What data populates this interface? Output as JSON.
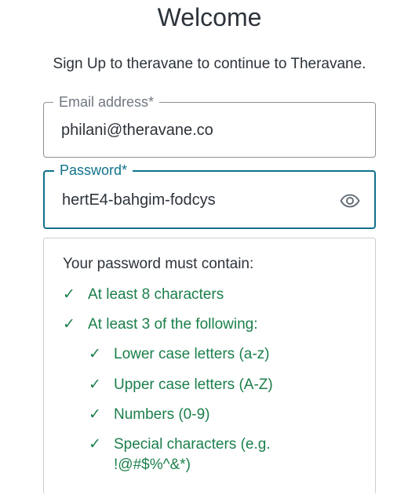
{
  "header": {
    "title": "Welcome",
    "subtitle": "Sign Up to theravane to continue to Theravane."
  },
  "form": {
    "email": {
      "label": "Email address*",
      "value": "philani@theravane.co"
    },
    "password": {
      "label": "Password*",
      "value": "hertE4-bahgim-fodcys",
      "toggle_icon": "eye-icon"
    }
  },
  "requirements": {
    "heading": "Your password must contain:",
    "check_glyph": "✓",
    "items": [
      {
        "label": "At least 8 characters",
        "met": true
      },
      {
        "label": "At least 3 of the following:",
        "met": true
      },
      {
        "label": "Lower case letters (a-z)",
        "met": true
      },
      {
        "label": "Upper case letters (A-Z)",
        "met": true
      },
      {
        "label": "Numbers (0-9)",
        "met": true
      },
      {
        "label": "Special characters (e.g. !@#$%^&*)",
        "met": true
      }
    ]
  },
  "colors": {
    "accent": "#10728c",
    "success": "#1b7f4a",
    "text": "#2d333a",
    "muted": "#6f7780"
  }
}
